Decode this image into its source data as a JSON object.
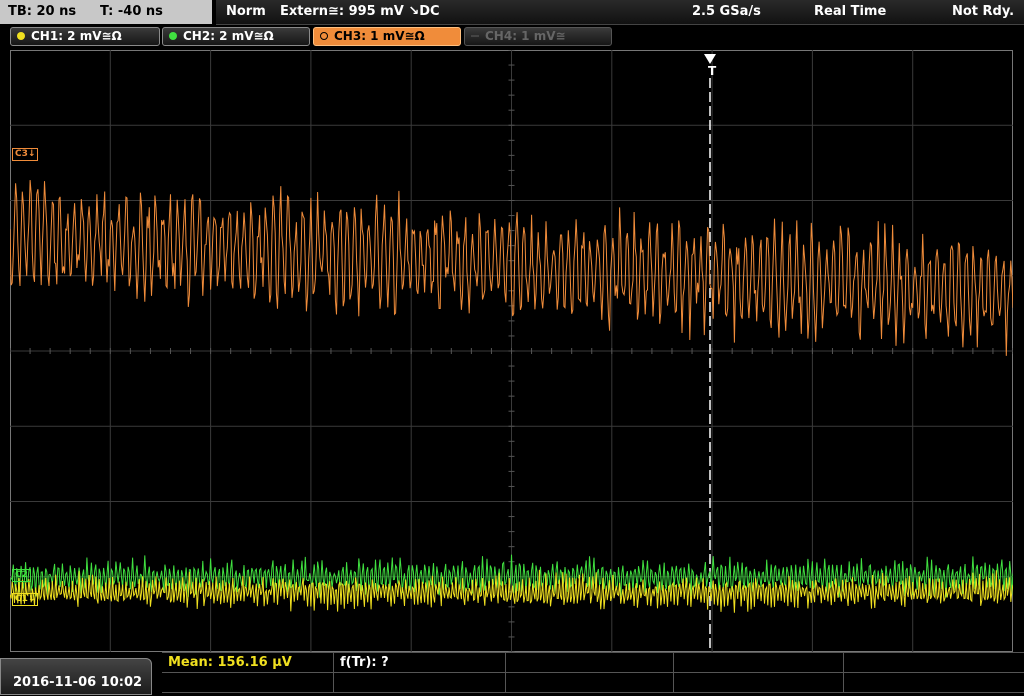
{
  "header": {
    "timebase": "TB: 20 ns",
    "trigger_time": "T: -40 ns",
    "mode": "Norm",
    "trigger_source": "Extern≅: 995 mV ↘DC",
    "sample_rate": "2.5 GSa/s",
    "acquisition": "Real Time",
    "status": "Not Rdy."
  },
  "channels": [
    {
      "label": "CH1: 2 mV≅Ω",
      "color": "#f0e020",
      "state": "on"
    },
    {
      "label": "CH2: 2 mV≅Ω",
      "color": "#40e040",
      "state": "on"
    },
    {
      "label": "CH3: 1 mV≅Ω",
      "color": "#f08c3a",
      "state": "selected"
    },
    {
      "label": "CH4: 1 mV≅",
      "color": "#555555",
      "state": "off"
    }
  ],
  "markers": {
    "ch3": "C3↓",
    "ch2": "C2",
    "ch1": "C1↓",
    "trigger": "T"
  },
  "footer": {
    "datetime": "2016-11-06 10:02",
    "measurement": "Mean: 156.16 µV",
    "measurement_color": "#f0e020",
    "freq": "f(Tr): ?"
  },
  "colors": {
    "ch1": "#f0e020",
    "ch2": "#40e040",
    "ch3": "#f08c3a",
    "grid": "#3a3a3a"
  }
}
